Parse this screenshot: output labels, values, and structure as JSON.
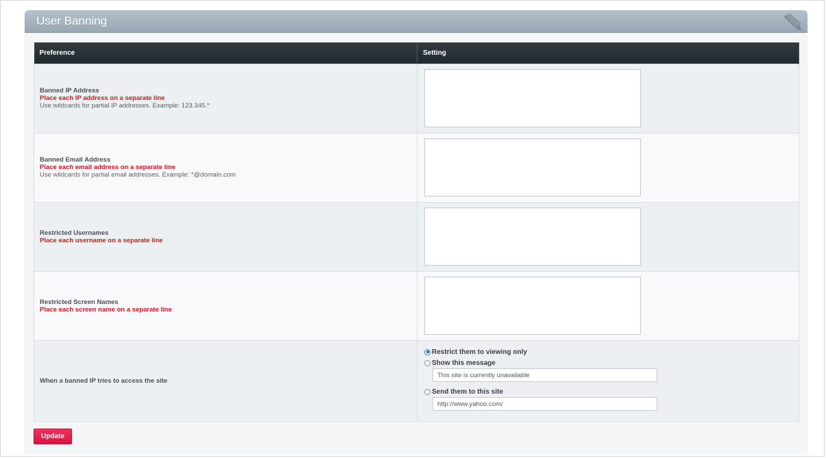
{
  "panel": {
    "title": "User Banning",
    "icon": "pencil-icon"
  },
  "table": {
    "headers": [
      "Preference",
      "Setting"
    ],
    "rows": [
      {
        "title": "Banned IP Address",
        "note": "Place each IP address on a separate line",
        "help": "Use wildcards for partial IP addresses. Example: 123.345.*",
        "value": ""
      },
      {
        "title": "Banned Email Address",
        "note": "Place each email address on a separate line",
        "help": "Use wildcards for partial email addresses. Example: *@domain.com",
        "value": ""
      },
      {
        "title": "Restricted Usernames",
        "note": "Place each username on a separate line",
        "value": ""
      },
      {
        "title": "Restricted Screen Names",
        "note": "Place each screen name on a separate line",
        "value": ""
      }
    ],
    "banned_action": {
      "label": "When a banned IP tries to access the site",
      "options": [
        {
          "label": "Restrict them to viewing only",
          "checked": true
        },
        {
          "label": "Show this message",
          "checked": false,
          "input_value": "This site is currently unavailable"
        },
        {
          "label": "Send them to this site",
          "checked": false,
          "input_value": "http://www.yahoo.com/"
        }
      ]
    }
  },
  "buttons": {
    "update_label": "Update"
  },
  "colors": {
    "header_bar": "#a7b5c0",
    "table_header": "#2b3338",
    "note_red": "#e0161e",
    "button_red": "#e3204b"
  }
}
